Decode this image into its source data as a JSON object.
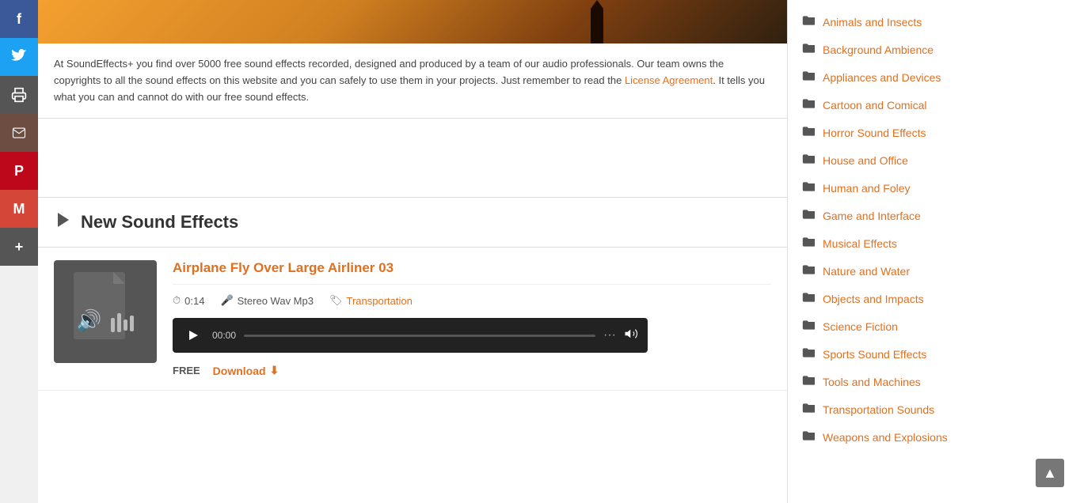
{
  "social": {
    "buttons": [
      {
        "id": "facebook",
        "label": "f",
        "class": "facebook"
      },
      {
        "id": "twitter",
        "label": "🐦",
        "class": "twitter"
      },
      {
        "id": "print",
        "label": "🖨",
        "class": "print"
      },
      {
        "id": "email",
        "label": "✉",
        "class": "email"
      },
      {
        "id": "pinterest",
        "label": "P",
        "class": "pinterest"
      },
      {
        "id": "gmail",
        "label": "M",
        "class": "gmail"
      },
      {
        "id": "more",
        "label": "+",
        "class": "more"
      }
    ]
  },
  "description": {
    "text1": "At SoundEffects+ you find over 5000 free sound effects recorded, designed and produced by a team of our audio professionals. Our team owns the copyrights to all the sound effects on this website and you can safely to use them in your projects. Just remember to read the ",
    "link_text": "License Agreement",
    "text2": ". It tells you what you can and cannot do with our free sound effects."
  },
  "section": {
    "title": "New Sound Effects",
    "icon": "▶"
  },
  "sound": {
    "title": "Airplane Fly Over Large Airliner 03",
    "duration": "0:14",
    "format": "Stereo Wav Mp3",
    "tag": "Transportation",
    "player": {
      "time": "00:00"
    },
    "free_label": "FREE",
    "download_label": "Download"
  },
  "sidebar": {
    "categories": [
      {
        "label": "Animals and Insects"
      },
      {
        "label": "Background Ambience"
      },
      {
        "label": "Appliances and Devices"
      },
      {
        "label": "Cartoon and Comical"
      },
      {
        "label": "Horror Sound Effects"
      },
      {
        "label": "House and Office"
      },
      {
        "label": "Human and Foley"
      },
      {
        "label": "Game and Interface"
      },
      {
        "label": "Musical Effects"
      },
      {
        "label": "Nature and Water"
      },
      {
        "label": "Objects and Impacts"
      },
      {
        "label": "Science Fiction"
      },
      {
        "label": "Sports Sound Effects"
      },
      {
        "label": "Tools and Machines"
      },
      {
        "label": "Transportation Sounds"
      },
      {
        "label": "Weapons and Explosions"
      }
    ]
  },
  "colors": {
    "accent": "#e07020",
    "sidebar_bg": "#fff",
    "text_dark": "#333",
    "text_muted": "#555"
  }
}
